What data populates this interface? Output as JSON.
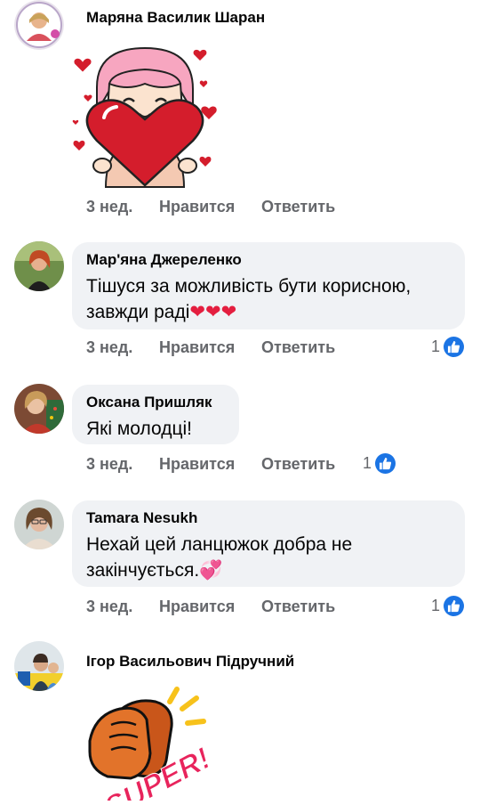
{
  "comments": [
    {
      "author": "Маряна Василик Шаран",
      "text": "",
      "has_sticker": true,
      "sticker": "girl-heart-sticker",
      "time": "3 нед.",
      "like_label": "Нравится",
      "reply_label": "Ответить",
      "reactions": ""
    },
    {
      "author": "Мар'яна Джереленко",
      "text_line1": "Тішуся за можливість бути корисною,",
      "text_line2": "завжди раді",
      "emoji": "❤❤❤",
      "time": "3 нед.",
      "like_label": "Нравится",
      "reply_label": "Ответить",
      "reactions": "1"
    },
    {
      "author": "Оксана Пришляк",
      "text": "Які молодці!",
      "time": "3 нед.",
      "like_label": "Нравится",
      "reply_label": "Ответить",
      "reactions": "1"
    },
    {
      "author": "Tamara Nesukh",
      "text_line1": "Нехай цей ланцюжок добра не",
      "text_line2": "закінчується.",
      "emoji": "💞",
      "time": "3 нед.",
      "like_label": "Нравится",
      "reply_label": "Ответить",
      "reactions": "1"
    },
    {
      "author": "Ігор Васильович Підручний",
      "has_sticker": true,
      "sticker": "super-clap-sticker",
      "sticker_text": "SUPER!"
    }
  ],
  "colors": {
    "bubble": "#f0f2f5",
    "meta": "#65676b",
    "like_blue": "#1b74e4",
    "heart_red": "#e41e3f"
  }
}
